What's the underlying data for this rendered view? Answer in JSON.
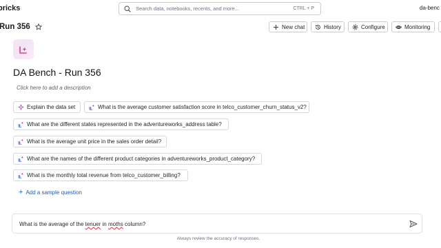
{
  "app": {
    "brand": "bricks",
    "workspace": "da-benc"
  },
  "search": {
    "placeholder": "Search data, notebooks, recents, and more...",
    "shortcut": "CTRL + P"
  },
  "header": {
    "title": "Run 356",
    "buttons": {
      "new_chat": "New chat",
      "history": "History",
      "configure": "Configure",
      "monitoring": "Monitoring"
    }
  },
  "space": {
    "title": "DA Bench - Run 356",
    "description_placeholder": "Click here to add a description"
  },
  "sample_questions": [
    "Explain the data set",
    "What is the average customer satisfaction score in telco_customer_churn_status_v2?",
    "What are the different states represented in the adventureworks_address table?",
    "What is the average unit price in the sales order detail?",
    "What are the names of the different product categories in adventureworks_product_category?",
    "What is the monthly total revenue from telco_customer_billing?"
  ],
  "add_sample_label": "Add a sample question",
  "composer": {
    "text_before": "What is the average of the ",
    "misspelled_1": "tenuer",
    "text_middle": " in ",
    "misspelled_2": "moths",
    "text_after": " column?"
  },
  "footer_note": "Always review the accuracy of responses.",
  "colors": {
    "accent": "#1a5fb4",
    "logo_pink": "#e0457b",
    "border": "#c9ccd1"
  },
  "icons": {
    "explain": "sparkle-icon",
    "question": "table-spark-icon",
    "send": "send-icon"
  }
}
